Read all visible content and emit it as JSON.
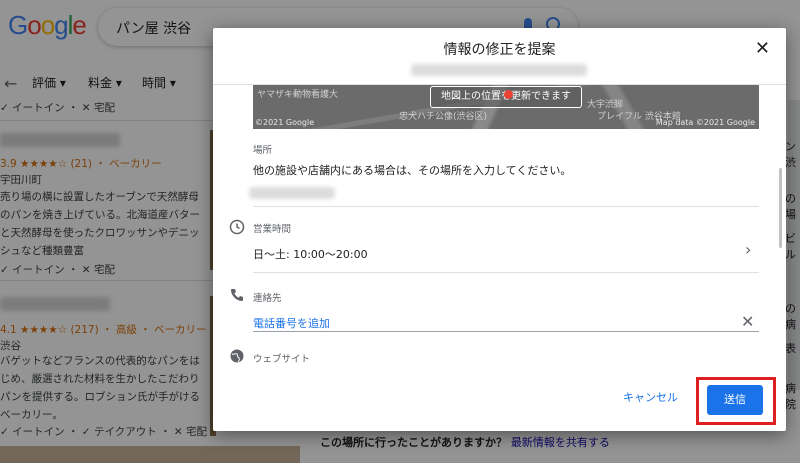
{
  "search": {
    "query": "パン屋 渋谷"
  },
  "filters": [
    "評価 ▾",
    "料金 ▾",
    "時間 ▾"
  ],
  "results": [
    {
      "tags_top": "✓ イートイン ・ ✕ 宅配",
      "rating_line": "3.9 ★★★★☆ (21) ・ ベーカリー",
      "area": "宇田川町",
      "desc": [
        "売り場の横に設置したオーブンで天然酵母",
        "のパンを焼き上げている。北海道産バター",
        "と天然酵母を使ったクロワッサンやデニッ",
        "シュなど種類豊富"
      ],
      "tags": "✓ イートイン ・ ✕ 宅配"
    },
    {
      "rating_line": "4.1 ★★★★☆ (217) ・ 高級 ・ ベーカリー",
      "area": "渋谷",
      "desc": [
        "バゲットなどフランスの代表的なパンをは",
        "じめ、厳選された材料を生かしたこだわり",
        "パンを提供する。ロブション氏が手がける",
        "ベーカリー。"
      ],
      "tags": "✓ イートイン ・ ✓ テイクアウト ・ ✕ 宅配"
    }
  ],
  "right_snippets": [
    "ン渋",
    "の場",
    "ビル",
    "の病",
    "表",
    "病院",
    "目黒"
  ],
  "bottom": {
    "question": "この場所に行ったことがありますか？",
    "link": "最新情報を共有する"
  },
  "dialog": {
    "title": "情報の修正を提案",
    "map_button": "地図上の位置を更新できます",
    "map_labels": [
      "ヤマザキ動物看護大",
      "忠犬ハチ公像(渋谷区)",
      "大宇渋脚",
      "プレイフル 渋谷本館"
    ],
    "map_footer_left": "©2021 Google",
    "map_footer_right": "Map data ©2021 Google",
    "location_label": "場所",
    "location_hint": "他の施設や店舗内にある場合は、その場所を入力してください。",
    "hours_label": "営業時間",
    "hours_value": "日〜土: 10:00〜20:00",
    "contact_label": "連絡先",
    "phone_link": "電話番号を追加",
    "website_label": "ウェブサイト",
    "cancel": "キャンセル",
    "send": "送信"
  }
}
